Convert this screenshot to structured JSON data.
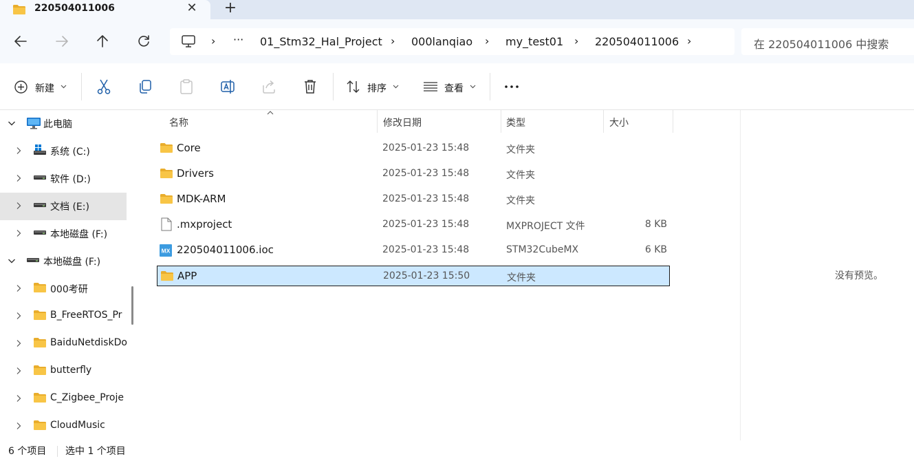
{
  "window": {
    "tab_title": "220504011006",
    "close_glyph": "✕",
    "new_tab_glyph": "+"
  },
  "address": {
    "overflow": "···",
    "crumbs": [
      "01_Stm32_Hal_Project",
      "000lanqiao",
      "my_test01",
      "220504011006"
    ],
    "search_placeholder": "在 220504011006 中搜索"
  },
  "toolbar": {
    "new_label": "新建",
    "sort_label": "排序",
    "view_label": "查看",
    "more_label": "···",
    "icons": [
      "cut-icon",
      "copy-icon",
      "paste-icon",
      "rename-icon",
      "share-icon",
      "delete-icon"
    ]
  },
  "sidebar": {
    "items": [
      {
        "label": "此电脑",
        "icon": "pc-icon",
        "expanded": true
      },
      {
        "label": "系统 (C:)",
        "icon": "drive-icon"
      },
      {
        "label": "软件 (D:)",
        "icon": "drive-icon"
      },
      {
        "label": "文档 (E:)",
        "icon": "drive-icon",
        "selected": true
      },
      {
        "label": "本地磁盘 (F:)",
        "icon": "drive-icon"
      },
      {
        "label": "本地磁盘 (F:)",
        "icon": "drive-icon",
        "expanded": true
      },
      {
        "label": "000考研",
        "icon": "folder-icon"
      },
      {
        "label": "B_FreeRTOS_Pr",
        "icon": "folder-icon"
      },
      {
        "label": "BaiduNetdiskDo",
        "icon": "folder-icon"
      },
      {
        "label": "butterfly",
        "icon": "folder-icon"
      },
      {
        "label": "C_Zigbee_Proje",
        "icon": "folder-icon"
      },
      {
        "label": "CloudMusic",
        "icon": "folder-icon"
      }
    ]
  },
  "filelist": {
    "columns": {
      "name": "名称",
      "date": "修改日期",
      "type": "类型",
      "size": "大小"
    },
    "rows": [
      {
        "name": "Core",
        "date": "2025-01-23 15:48",
        "type": "文件夹",
        "size": "",
        "icon": "folder-icon"
      },
      {
        "name": "Drivers",
        "date": "2025-01-23 15:48",
        "type": "文件夹",
        "size": "",
        "icon": "folder-icon"
      },
      {
        "name": "MDK-ARM",
        "date": "2025-01-23 15:48",
        "type": "文件夹",
        "size": "",
        "icon": "folder-icon"
      },
      {
        "name": ".mxproject",
        "date": "2025-01-23 15:48",
        "type": "MXPROJECT 文件",
        "size": "8 KB",
        "icon": "file-icon"
      },
      {
        "name": "220504011006.ioc",
        "date": "2025-01-23 15:48",
        "type": "STM32CubeMX",
        "size": "6 KB",
        "icon": "mx-icon"
      },
      {
        "name": "APP",
        "date": "2025-01-23 15:50",
        "type": "文件夹",
        "size": "",
        "icon": "folder-icon",
        "selected": true
      }
    ]
  },
  "preview": {
    "text": "没有预览。"
  },
  "status": {
    "count": "6 个项目",
    "selected": "选中 1 个项目"
  },
  "colors": {
    "accent": "#0067c0",
    "folder": "#f8c546",
    "selection": "#cce8ff",
    "tab_strip": "#dfe7f3",
    "address_bg": "#f6f9fd"
  }
}
